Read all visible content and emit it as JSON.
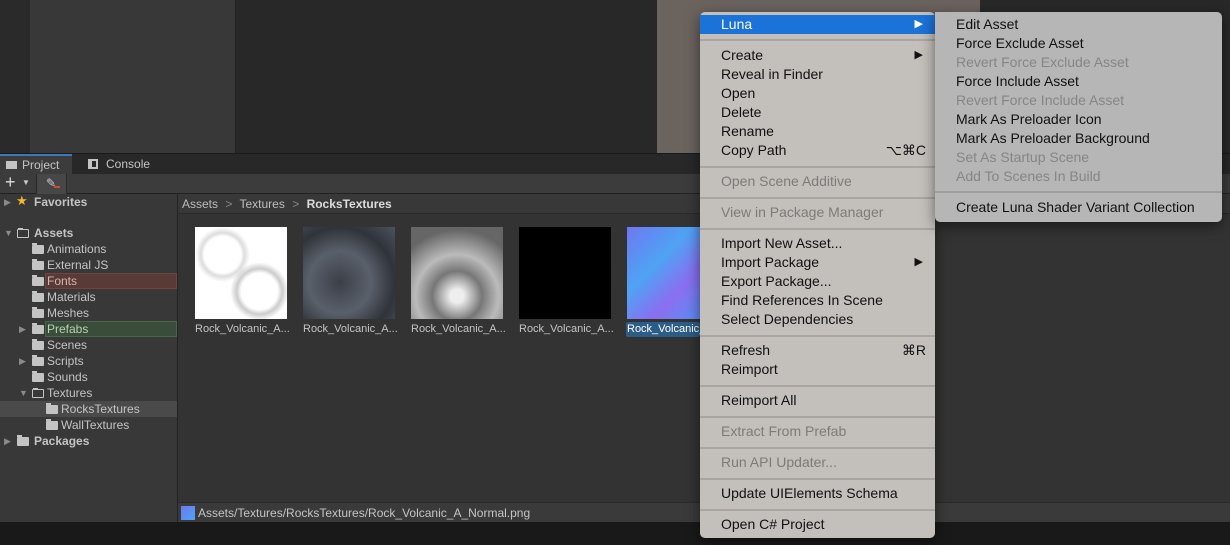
{
  "tabs": [
    {
      "label": "Project",
      "icon": "folder-icon",
      "active": true
    },
    {
      "label": "Console",
      "icon": "console-icon",
      "active": false
    }
  ],
  "toolbar": {
    "add_label": "+",
    "add_icon": "plus-dropdown-icon",
    "label_icon": "label-edit-icon"
  },
  "tree": {
    "favorites": "Favorites",
    "assets": "Assets",
    "children": [
      "Animations",
      "External JS",
      "Fonts",
      "Materials",
      "Meshes",
      "Prefabs",
      "Scenes",
      "Scripts",
      "Sounds",
      "Textures"
    ],
    "textures_children": [
      "RocksTextures",
      "WallTextures"
    ],
    "packages": "Packages",
    "highlight_colors": {
      "Fonts": "#5a3a36",
      "Prefabs": "#3a4d3a"
    },
    "selected": "RocksTextures"
  },
  "breadcrumb": [
    "Assets",
    "Textures",
    "RocksTextures"
  ],
  "breadcrumb_sep": ">",
  "assets": [
    {
      "label": "Rock_Volcanic_A..."
    },
    {
      "label": "Rock_Volcanic_A..."
    },
    {
      "label": "Rock_Volcanic_A..."
    },
    {
      "label": "Rock_Volcanic_A..."
    },
    {
      "label": "Rock_Volcanic_",
      "selected": true
    }
  ],
  "status_path": "Assets/Textures/RocksTextures/Rock_Volcanic_A_Normal.png",
  "menu": {
    "items": [
      {
        "label": "Luna",
        "submenu": true,
        "highlighted": true
      },
      {
        "label": "Create",
        "submenu": true
      },
      {
        "label": "Reveal in Finder"
      },
      {
        "label": "Open"
      },
      {
        "label": "Delete"
      },
      {
        "label": "Rename"
      },
      {
        "label": "Copy Path",
        "shortcut": "⌥⌘C"
      },
      {
        "label": "Open Scene Additive",
        "disabled": true
      },
      {
        "label": "View in Package Manager",
        "disabled": true
      },
      {
        "label": "Import New Asset..."
      },
      {
        "label": "Import Package",
        "submenu": true
      },
      {
        "label": "Export Package..."
      },
      {
        "label": "Find References In Scene"
      },
      {
        "label": "Select Dependencies"
      },
      {
        "label": "Refresh",
        "shortcut": "⌘R"
      },
      {
        "label": "Reimport"
      },
      {
        "label": "Reimport All"
      },
      {
        "label": "Extract From Prefab",
        "disabled": true
      },
      {
        "label": "Run API Updater...",
        "disabled": true
      },
      {
        "label": "Update UIElements Schema"
      },
      {
        "label": "Open C# Project"
      }
    ]
  },
  "submenu": {
    "items": [
      {
        "label": "Edit Asset"
      },
      {
        "label": "Force Exclude Asset"
      },
      {
        "label": "Revert Force Exclude Asset",
        "disabled": true
      },
      {
        "label": "Force Include Asset"
      },
      {
        "label": "Revert Force Include Asset",
        "disabled": true
      },
      {
        "label": "Mark As Preloader Icon"
      },
      {
        "label": "Mark As Preloader Background"
      },
      {
        "label": "Set As Startup Scene",
        "disabled": true
      },
      {
        "label": "Add To Scenes In Build",
        "disabled": true
      },
      {
        "label": "Create Luna Shader Variant Collection"
      }
    ]
  },
  "colors": {
    "highlight": "#1b72d8",
    "selection": "#2c5d87",
    "accent_tab": "#3a79bb"
  }
}
